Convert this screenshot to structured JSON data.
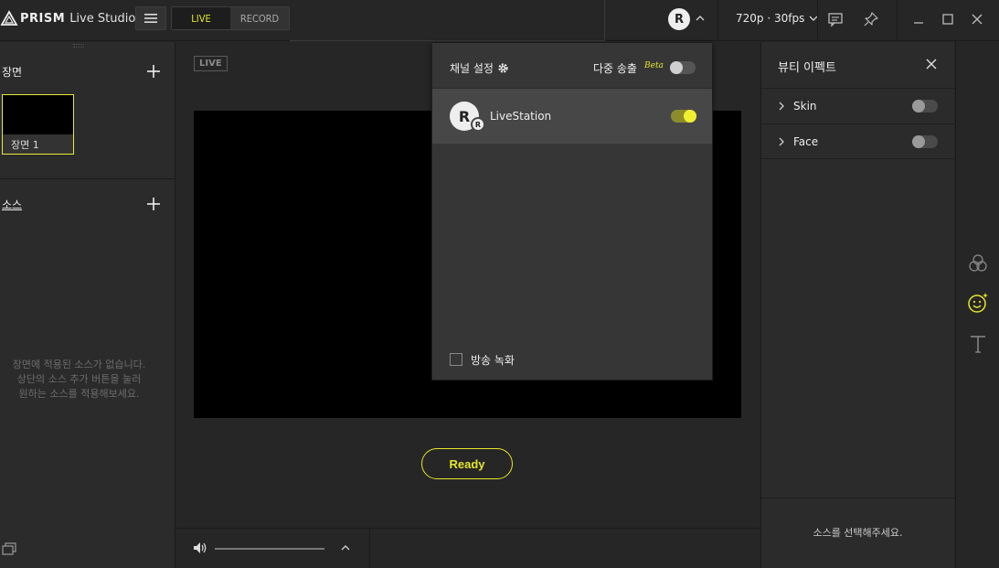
{
  "app": {
    "brand": "PRISM",
    "subtitle": "Live Studio"
  },
  "topbar": {
    "mode_tabs": [
      {
        "label": "LIVE",
        "active": true
      },
      {
        "label": "RECORD",
        "active": false
      }
    ],
    "avatar_letter": "R",
    "resolution": "720p · 30fps"
  },
  "left_panel": {
    "scenes_title": "장면",
    "scene_items": [
      {
        "label": "장면 1",
        "selected": true
      }
    ],
    "sources_title": "소스",
    "empty_message_lines": [
      "장면에 적용된 소스가 없습니다.",
      "상단의 소스 추가 버튼을 눌러",
      "원하는 소스를 적용해보세요."
    ]
  },
  "center": {
    "live_badge": "LIVE",
    "ready_label": "Ready",
    "volume_level": 1.0
  },
  "channel_dropdown": {
    "title": "채널 설정",
    "multi_stream_label": "다중 송출",
    "beta_label": "Beta",
    "multi_stream_on": false,
    "channels": [
      {
        "avatar_letter": "R",
        "badge_letter": "R",
        "name": "LiveStation",
        "enabled": true
      }
    ],
    "record_checkbox_label": "방송 녹화",
    "record_checked": false
  },
  "right_panel": {
    "title": "뷰티 이펙트",
    "rows": [
      {
        "label": "Skin",
        "enabled": false
      },
      {
        "label": "Face",
        "enabled": false
      }
    ],
    "select_source_message": "소스를 선택해주세요."
  },
  "side_strip": {
    "icons": [
      "color-filter-icon",
      "beauty-effect-icon",
      "text-icon"
    ],
    "active_icon": "beauty-effect-icon",
    "accent_color": "#e6e62c"
  }
}
